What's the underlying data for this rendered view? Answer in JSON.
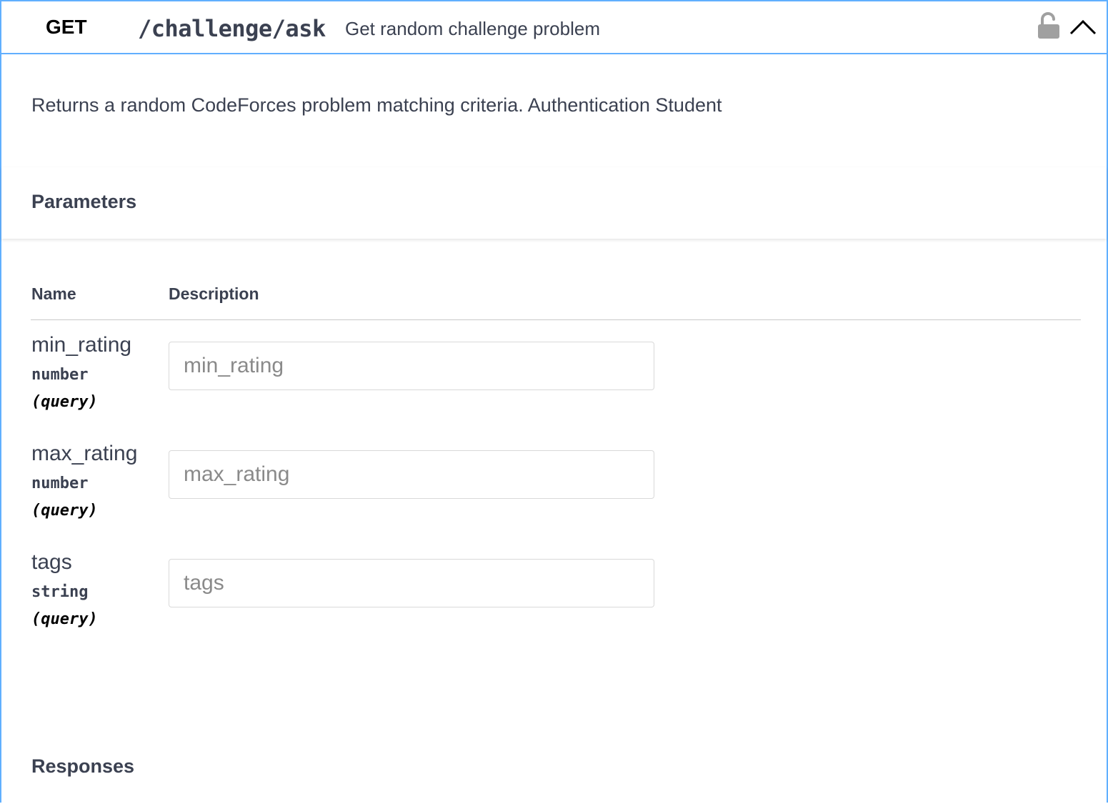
{
  "operation": {
    "method": "GET",
    "path": "/challenge/ask",
    "summary": "Get random challenge problem",
    "description": "Returns a random CodeForces problem matching criteria. Authentication Student",
    "icons": {
      "lock": "lock-open-icon",
      "collapse": "chevron-up-icon"
    },
    "colors": {
      "accent": "#61affe",
      "background": "#eef5fc"
    }
  },
  "parameters": {
    "title": "Parameters",
    "columns": {
      "name": "Name",
      "description": "Description"
    },
    "items": [
      {
        "name": "min_rating",
        "type": "number",
        "in": "(query)",
        "placeholder": "min_rating",
        "value": ""
      },
      {
        "name": "max_rating",
        "type": "number",
        "in": "(query)",
        "placeholder": "max_rating",
        "value": ""
      },
      {
        "name": "tags",
        "type": "string",
        "in": "(query)",
        "placeholder": "tags",
        "value": ""
      }
    ]
  },
  "responses": {
    "title": "Responses"
  }
}
